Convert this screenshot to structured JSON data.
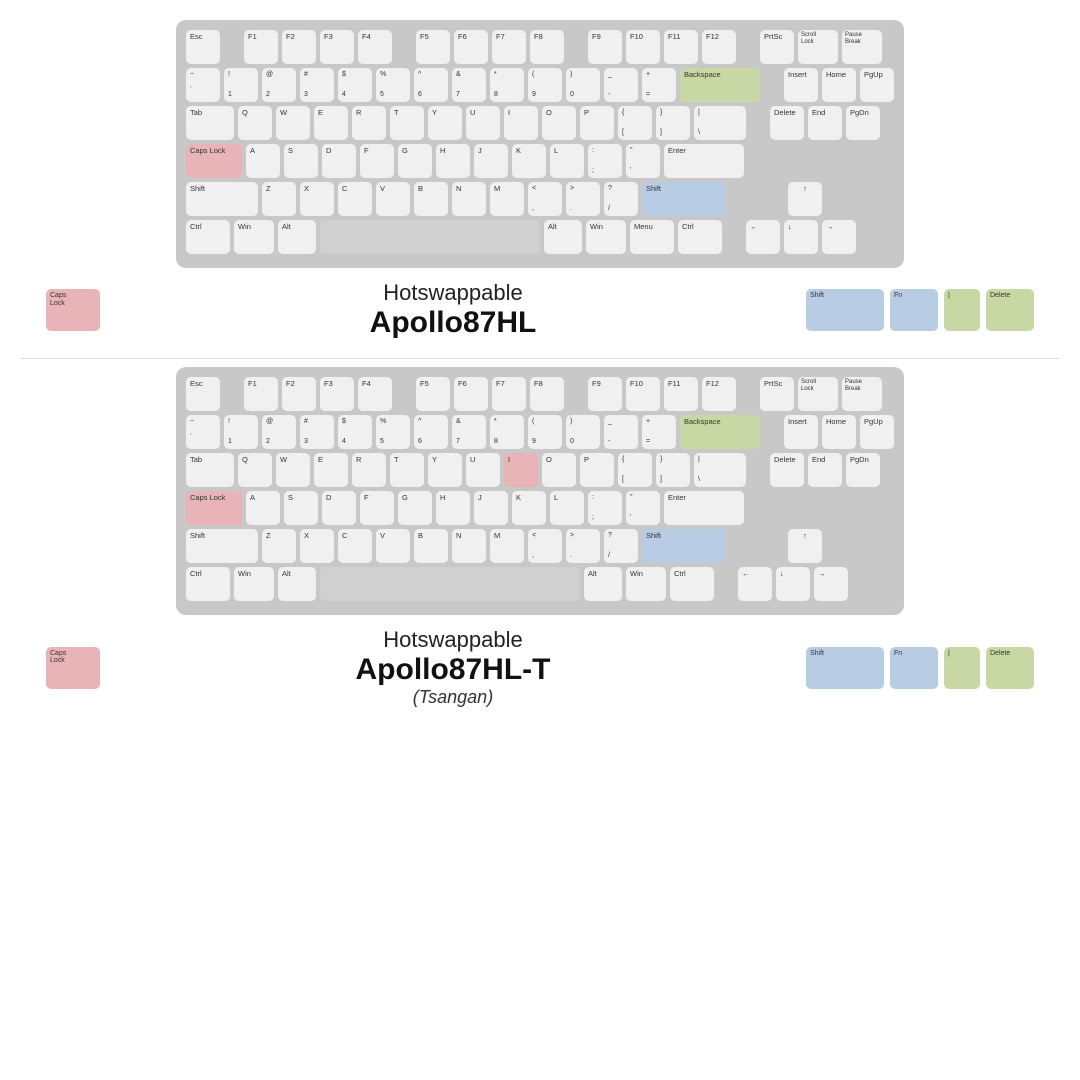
{
  "keyboard1": {
    "title_hotswappable": "Hotswappable",
    "title_model": "Apollo87HL",
    "title_sub": "",
    "rows": {
      "r0": [
        "Esc",
        "",
        "F1",
        "F2",
        "F3",
        "F4",
        "",
        "F5",
        "F6",
        "F7",
        "F8",
        "",
        "F9",
        "F10",
        "F11",
        "F12"
      ],
      "nav_right": [
        "PrtSc",
        "Scroll\nLock",
        "Pause\nBreak",
        "Insert",
        "Home",
        "PgUp",
        "Delete",
        "End",
        "PgDn"
      ]
    },
    "extras": {
      "caps_lock": "Caps\nLock",
      "shift": "Shift",
      "fn": "Fn",
      "pipe": "|",
      "delete": "Delete"
    }
  },
  "keyboard2": {
    "title_hotswappable": "Hotswappable",
    "title_model": "Apollo87HL-T",
    "title_sub": "(Tsangan)",
    "extras": {
      "caps_lock": "Caps\nLock",
      "shift": "Shift",
      "fn": "Fn",
      "pipe": "|",
      "delete": "Delete"
    }
  }
}
